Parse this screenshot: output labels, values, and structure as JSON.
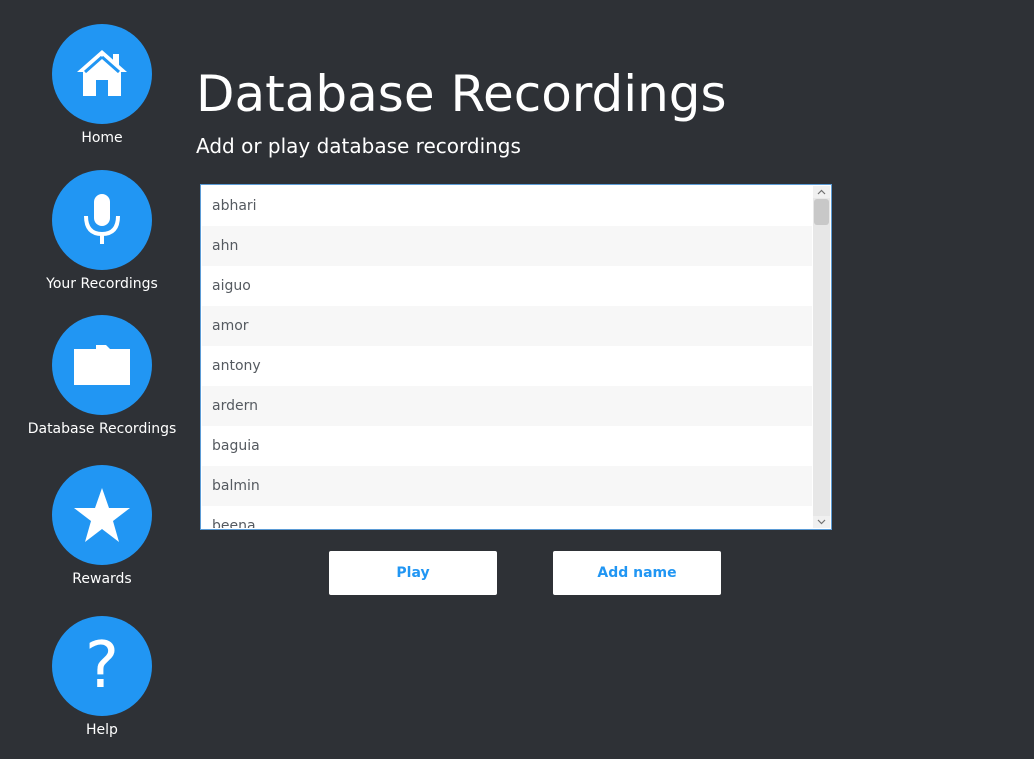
{
  "sidebar": {
    "items": [
      {
        "label": "Home",
        "icon": "home-icon"
      },
      {
        "label": "Your Recordings",
        "icon": "microphone-icon"
      },
      {
        "label": "Database Recordings",
        "icon": "folder-icon"
      },
      {
        "label": "Rewards",
        "icon": "star-icon"
      },
      {
        "label": "Help",
        "icon": "help-icon"
      }
    ],
    "help_glyph": "?"
  },
  "header": {
    "title": "Database Recordings",
    "subtitle": "Add or play database recordings"
  },
  "recordings_list": {
    "items": [
      "abhari",
      "ahn",
      "aiguo",
      "amor",
      "antony",
      "ardern",
      "baguia",
      "balmin",
      "beena"
    ]
  },
  "actions": {
    "play_label": "Play",
    "add_name_label": "Add name"
  },
  "colors": {
    "background": "#2e3136",
    "accent": "#2196f3",
    "list_border": "#5b9bd5"
  }
}
